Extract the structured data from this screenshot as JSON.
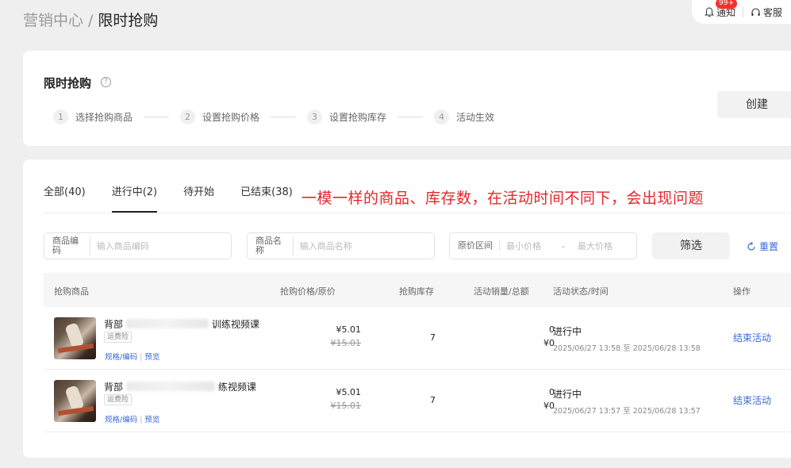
{
  "breadcrumb": {
    "parent": "营销中心",
    "separator": "/",
    "current": "限时抢购"
  },
  "topbar": {
    "notify_label": "通知",
    "notify_badge": "99+",
    "service_label": "客服"
  },
  "header": {
    "title": "限时抢购",
    "help_icon": "?",
    "create_label": "创建",
    "steps": [
      {
        "num": "1",
        "label": "选择抢购商品"
      },
      {
        "num": "2",
        "label": "设置抢购价格"
      },
      {
        "num": "3",
        "label": "设置抢购库存"
      },
      {
        "num": "4",
        "label": "活动生效"
      }
    ]
  },
  "tabs": [
    {
      "label": "全部(40)",
      "active": false
    },
    {
      "label": "进行中(2)",
      "active": true
    },
    {
      "label": "待开始",
      "active": false
    },
    {
      "label": "已结束(38)",
      "active": false
    }
  ],
  "annotation": "一模一样的商品、库存数，在活动时间不同下，会出现问题",
  "filters": {
    "code_label": "商品编码",
    "code_placeholder": "输入商品编码",
    "name_label": "商品名称",
    "name_placeholder": "输入商品名称",
    "range_label": "原价区间",
    "min_placeholder": "最小价格",
    "range_sep": "-",
    "max_placeholder": "最大价格",
    "filter_btn": "筛选",
    "reset_label": "重置"
  },
  "table": {
    "headers": [
      "抢购商品",
      "抢购价格/原价",
      "抢购库存",
      "活动销量/总额",
      "活动状态/时间",
      "操作"
    ],
    "rows": [
      {
        "name_prefix": "背部",
        "name_suffix": "训练视频课",
        "tag": "运费险",
        "link1": "规格/编码",
        "link_sep": "|",
        "link2": "预览",
        "price": "¥5.01",
        "orig_price": "¥15.01",
        "stock": "7",
        "sales": "0",
        "total": "¥0",
        "status": "进行中",
        "time": "2025/06/27 13:58 至 2025/06/28 13:58",
        "action": "结束活动"
      },
      {
        "name_prefix": "背部",
        "name_suffix": "练视频课",
        "tag": "运费险",
        "link1": "规格/编码",
        "link_sep": "|",
        "link2": "预览",
        "price": "¥5.01",
        "orig_price": "¥15.01",
        "stock": "7",
        "sales": "0",
        "total": "¥0",
        "status": "进行中",
        "time": "2025/06/27 13:57 至 2025/06/28 13:57",
        "action": "结束活动"
      }
    ]
  },
  "colors": {
    "annotation": "#e5262b",
    "link": "#3a6bd4",
    "badge": "#f5312f"
  }
}
